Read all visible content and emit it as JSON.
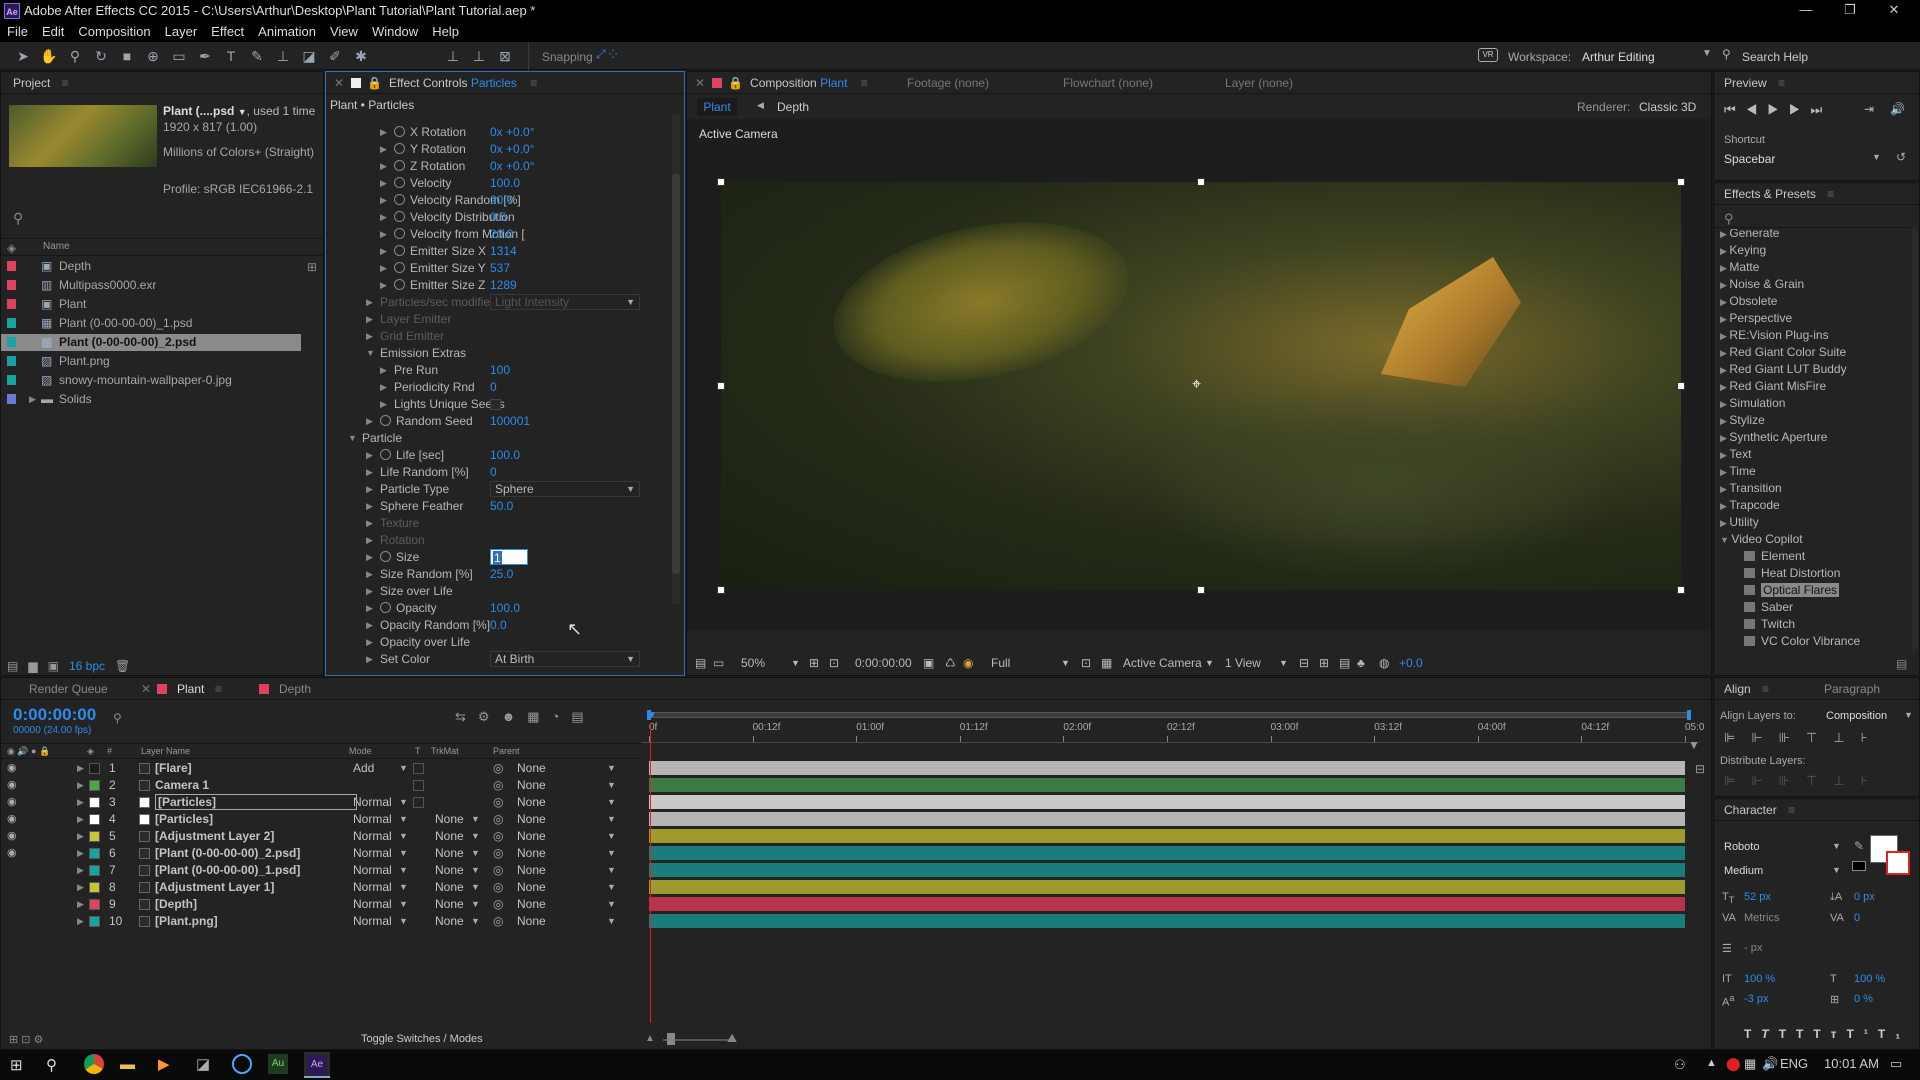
{
  "window": {
    "title": "Adobe After Effects CC 2015 - C:\\Users\\Arthur\\Desktop\\Plant Tutorial\\Plant Tutorial.aep *",
    "app_badge": "Ae"
  },
  "menu": [
    "File",
    "Edit",
    "Composition",
    "Layer",
    "Effect",
    "Animation",
    "View",
    "Window",
    "Help"
  ],
  "toolbar": {
    "snapping": "Snapping",
    "workspace_label": "Workspace:",
    "workspace_value": "Arthur Editing",
    "search_help": "Search Help"
  },
  "project": {
    "tab": "Project",
    "item_name": "Plant (....psd",
    "used": ", used 1 time",
    "dims": "1920 x 817 (1.00)",
    "colors": "Millions of Colors+ (Straight)",
    "profile": "Profile: sRGB IEC61966-2.1",
    "col_name": "Name",
    "bpc": "16 bpc",
    "items": [
      {
        "name": "Depth",
        "color": "#e0435f",
        "type": "comp"
      },
      {
        "name": "Multipass0000.exr",
        "color": "#e0435f",
        "type": "file"
      },
      {
        "name": "Plant",
        "color": "#e0435f",
        "type": "comp"
      },
      {
        "name": "Plant (0-00-00-00)_1.psd",
        "color": "#18a3a3",
        "type": "psd"
      },
      {
        "name": "Plant (0-00-00-00)_2.psd",
        "color": "#18a3a3",
        "type": "psd"
      },
      {
        "name": "Plant.png",
        "color": "#18a3a3",
        "type": "img"
      },
      {
        "name": "snowy-mountain-wallpaper-0.jpg",
        "color": "#18a3a3",
        "type": "img"
      },
      {
        "name": "Solids",
        "color": "#6c7ad8",
        "type": "folder"
      }
    ]
  },
  "effect_controls": {
    "tab": "Effect Controls",
    "layer": "Particles",
    "breadcrumb": "Plant • Particles",
    "rows": [
      {
        "label": "X Rotation",
        "value": "0x +0.0°",
        "indent": 2,
        "stop": true
      },
      {
        "label": "Y Rotation",
        "value": "0x +0.0°",
        "indent": 2,
        "stop": true
      },
      {
        "label": "Z Rotation",
        "value": "0x +0.0°",
        "indent": 2,
        "stop": true
      },
      {
        "label": "Velocity",
        "value": "100.0",
        "indent": 2,
        "stop": true
      },
      {
        "label": "Velocity Random [%]",
        "value": "20.0",
        "indent": 2,
        "stop": true
      },
      {
        "label": "Velocity Distribution",
        "value": "0.5",
        "indent": 2,
        "stop": true
      },
      {
        "label": "Velocity from Motion [",
        "value": "20.0",
        "indent": 2,
        "stop": true
      },
      {
        "label": "Emitter Size X",
        "value": "1314",
        "indent": 2,
        "stop": true
      },
      {
        "label": "Emitter Size Y",
        "value": "537",
        "indent": 2,
        "stop": true
      },
      {
        "label": "Emitter Size Z",
        "value": "1289",
        "indent": 2,
        "stop": true
      },
      {
        "label": "Particles/sec modifier",
        "value": "Light Intensity",
        "indent": 1,
        "dim": true,
        "select": true
      },
      {
        "label": "Layer Emitter",
        "value": "",
        "indent": 1,
        "dim": true
      },
      {
        "label": "Grid Emitter",
        "value": "",
        "indent": 1,
        "dim": true
      },
      {
        "label": "Emission Extras",
        "value": "",
        "indent": 1,
        "open": true
      },
      {
        "label": "Pre Run",
        "value": "100",
        "indent": 2
      },
      {
        "label": "Periodicity Rnd",
        "value": "0",
        "indent": 2
      },
      {
        "label": "Lights Unique Seeds",
        "value": "",
        "indent": 2,
        "checkbox": true
      },
      {
        "label": "Random Seed",
        "value": "100001",
        "indent": 1,
        "stop": true
      },
      {
        "label": "Particle",
        "value": "",
        "indent": 0,
        "open": true
      },
      {
        "label": "Life [sec]",
        "value": "100.0",
        "indent": 1,
        "stop": true
      },
      {
        "label": "Life Random [%]",
        "value": "0",
        "indent": 1
      },
      {
        "label": "Particle Type",
        "value": "Sphere",
        "indent": 1,
        "select": true
      },
      {
        "label": "Sphere Feather",
        "value": "50.0",
        "indent": 1
      },
      {
        "label": "Texture",
        "value": "",
        "indent": 1,
        "dim": true
      },
      {
        "label": "Rotation",
        "value": "",
        "indent": 1,
        "dim": true
      },
      {
        "label": "Size",
        "value": "1",
        "indent": 1,
        "stop": true,
        "editing": true
      },
      {
        "label": "Size Random [%]",
        "value": "25.0",
        "indent": 1
      },
      {
        "label": "Size over Life",
        "value": "",
        "indent": 1
      },
      {
        "label": "Opacity",
        "value": "100.0",
        "indent": 1,
        "stop": true
      },
      {
        "label": "Opacity Random [%]",
        "value": "0.0",
        "indent": 1
      },
      {
        "label": "Opacity over Life",
        "value": "",
        "indent": 1
      },
      {
        "label": "Set Color",
        "value": "At Birth",
        "indent": 1,
        "select": true
      }
    ]
  },
  "comp_viewer": {
    "tab": "Composition",
    "comp": "Plant",
    "tabs_other": [
      "Footage (none)",
      "Flowchart (none)",
      "Layer (none)"
    ],
    "nav_current": "Plant",
    "nav_next": "Depth",
    "renderer_label": "Renderer:",
    "renderer": "Classic 3D",
    "active_camera": "Active Camera",
    "footer": {
      "zoom": "50%",
      "timecode": "0:00:00:00",
      "resolution": "Full",
      "view": "Active Camera",
      "views": "1 View",
      "exposure": "+0.0"
    }
  },
  "preview": {
    "tab": "Preview",
    "shortcut_label": "Shortcut",
    "shortcut": "Spacebar"
  },
  "effects_presets": {
    "tab": "Effects & Presets",
    "categories": [
      "Generate",
      "Keying",
      "Matte",
      "Noise & Grain",
      "Obsolete",
      "Perspective",
      "RE:Vision Plug-ins",
      "Red Giant Color Suite",
      "Red Giant LUT Buddy",
      "Red Giant MisFire",
      "Simulation",
      "Stylize",
      "Synthetic Aperture",
      "Text",
      "Time",
      "Transition",
      "Trapcode",
      "Utility",
      "Video Copilot"
    ],
    "vc_items": [
      "Element",
      "Heat Distortion",
      "Optical Flares",
      "Saber",
      "Twitch",
      "VC Color Vibrance"
    ],
    "highlighted": "Optical Flares"
  },
  "timeline": {
    "tabs": [
      "Render Queue",
      "Plant",
      "Depth"
    ],
    "timecode": "0:00:00:00",
    "frames": "00000 (24.00 fps)",
    "cols": {
      "layer_name": "Layer Name",
      "mode": "Mode",
      "t": "T",
      "trkmat": "TrkMat",
      "parent": "Parent"
    },
    "ruler": [
      "0f",
      "00:12f",
      "01:00f",
      "01:12f",
      "02:00f",
      "02:12f",
      "03:00f",
      "03:12f",
      "04:00f",
      "04:12f",
      "05:0"
    ],
    "toggle": "Toggle Switches / Modes",
    "layers": [
      {
        "num": "1",
        "name": "[Flare]",
        "label": "#1a1a1a",
        "mode": "Add",
        "trk": "",
        "parent": "None",
        "bar": "#b5b5b5",
        "eye": true
      },
      {
        "num": "2",
        "name": "Camera 1",
        "label": "#4aa84a",
        "mode": "",
        "trk": "",
        "parent": "None",
        "bar": "#3e7a45",
        "eye": true
      },
      {
        "num": "3",
        "name": "[Particles]",
        "label": "#ffffff",
        "mode": "Normal",
        "trk": "",
        "parent": "None",
        "bar": "#c9c9c9",
        "eye": true,
        "selected": true
      },
      {
        "num": "4",
        "name": "[Particles]",
        "label": "#ffffff",
        "mode": "Normal",
        "trk": "None",
        "parent": "None",
        "bar": "#b5b5b5",
        "eye": true
      },
      {
        "num": "5",
        "name": "[Adjustment Layer 2]",
        "label": "#c9c33a",
        "mode": "Normal",
        "trk": "None",
        "parent": "None",
        "bar": "#9e9a2e",
        "eye": true
      },
      {
        "num": "6",
        "name": "[Plant (0-00-00-00)_2.psd]",
        "label": "#18a3a3",
        "mode": "Normal",
        "trk": "None",
        "parent": "None",
        "bar": "#1b7c7c",
        "eye": true
      },
      {
        "num": "7",
        "name": "[Plant (0-00-00-00)_1.psd]",
        "label": "#18a3a3",
        "mode": "Normal",
        "trk": "None",
        "parent": "None",
        "bar": "#1b7c7c",
        "eye": false
      },
      {
        "num": "8",
        "name": "[Adjustment Layer 1]",
        "label": "#c9c33a",
        "mode": "Normal",
        "trk": "None",
        "parent": "None",
        "bar": "#9e9a2e",
        "eye": false
      },
      {
        "num": "9",
        "name": "[Depth]",
        "label": "#e0435f",
        "mode": "Normal",
        "trk": "None",
        "parent": "None",
        "bar": "#b8334c",
        "eye": false
      },
      {
        "num": "10",
        "name": "[Plant.png]",
        "label": "#18a3a3",
        "mode": "Normal",
        "trk": "None",
        "parent": "None",
        "bar": "#1b7c7c",
        "eye": false
      }
    ]
  },
  "align": {
    "tab": "Align",
    "tab2": "Paragraph",
    "align_to_label": "Align Layers to:",
    "align_to": "Composition",
    "distribute": "Distribute Layers:"
  },
  "character": {
    "tab": "Character",
    "font": "Roboto",
    "style": "Medium",
    "size": "52 px",
    "leading": "0 px",
    "kerning": "Metrics",
    "tracking": "0",
    "line": "- px",
    "vscale": "100 %",
    "hscale": "100 %",
    "baseline": "-3 px",
    "tsume": "0 %"
  },
  "taskbar": {
    "lang": "ENG",
    "time": "10:01 AM"
  }
}
